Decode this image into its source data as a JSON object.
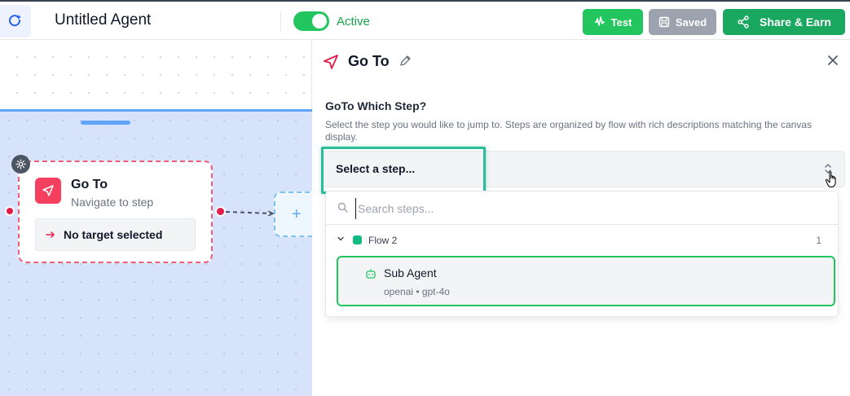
{
  "header": {
    "agent_title": "Untitled Agent",
    "status_label": "Active",
    "test_label": "Test",
    "saved_label": "Saved",
    "share_label": "Share & Earn"
  },
  "canvas": {
    "node": {
      "title": "Go To",
      "subtitle": "Navigate to step",
      "target_label": "No target selected"
    },
    "add_icon": "+"
  },
  "panel": {
    "title": "Go To",
    "question_label": "GoTo Which Step?",
    "question_description": "Select the step you would like to jump to. Steps are organized by flow with rich descriptions matching the canvas display.",
    "select_value": "Select a step...",
    "search_placeholder": "Search steps...",
    "flows": [
      {
        "name": "Flow 2",
        "count": "1",
        "steps": [
          {
            "title": "Sub Agent",
            "meta": "openai • gpt-4o"
          }
        ]
      }
    ]
  },
  "colors": {
    "accent_green": "#22c55e",
    "share_green": "#1aa760",
    "node_red": "#f43f5e",
    "highlight_teal": "#2bbd9a",
    "flow_region_blue": "#d7e3fb"
  }
}
